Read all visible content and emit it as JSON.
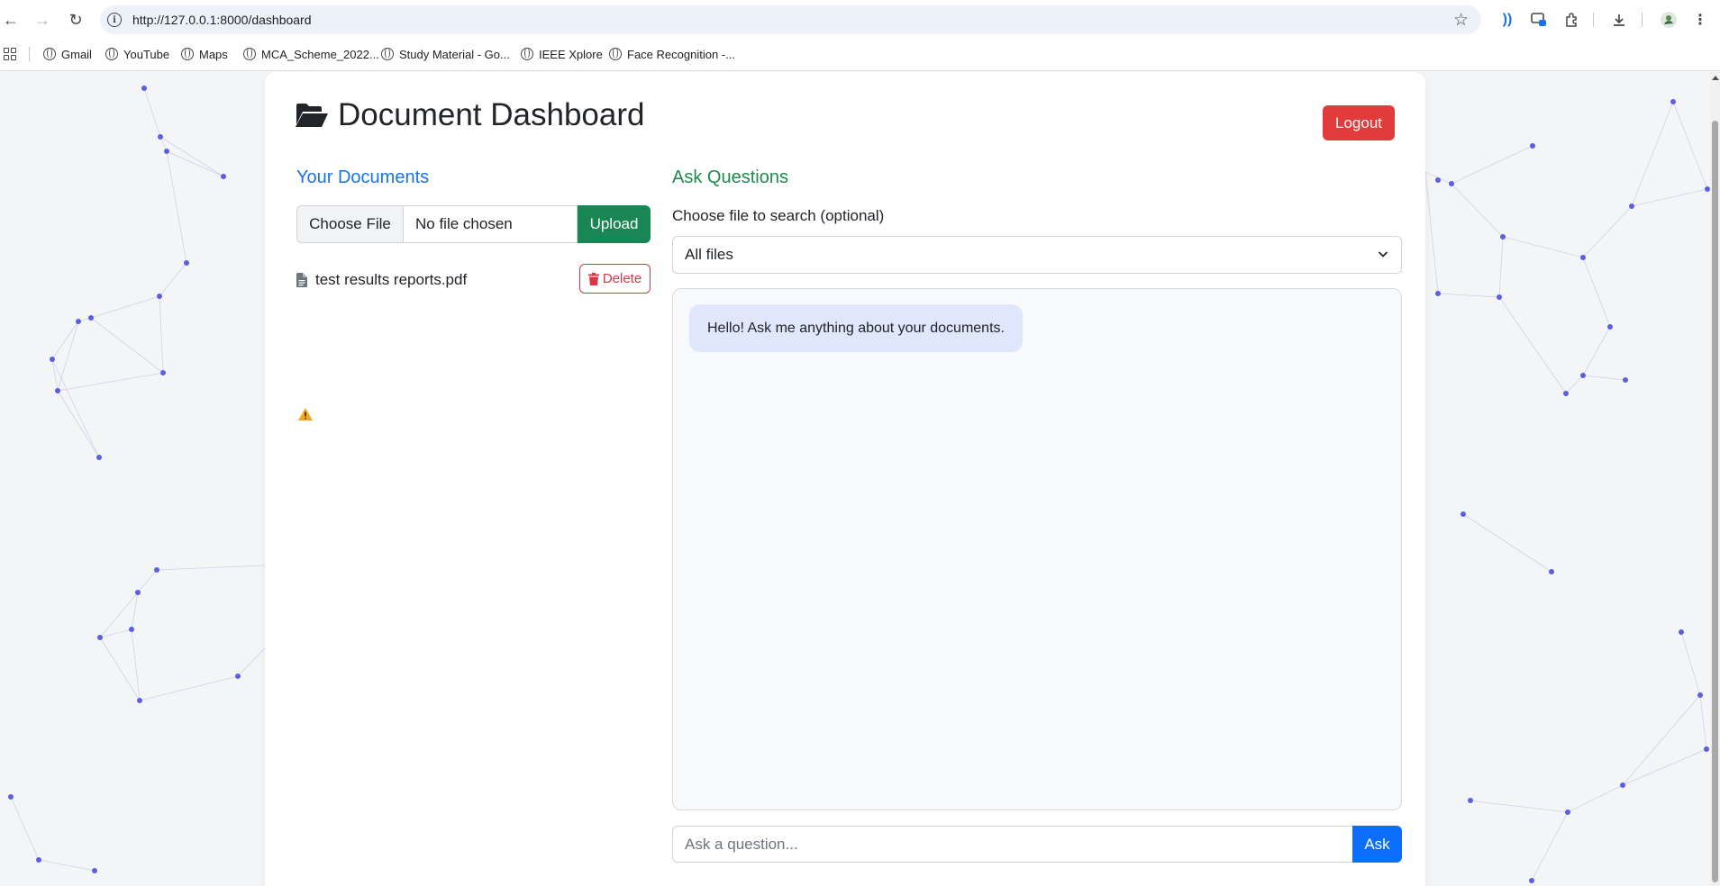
{
  "browser": {
    "url": "http://127.0.0.1:8000/dashboard",
    "bookmarks": [
      {
        "label": "Gmail"
      },
      {
        "label": "YouTube"
      },
      {
        "label": "Maps"
      },
      {
        "label": "MCA_Scheme_2022..."
      },
      {
        "label": "Study Material - Go..."
      },
      {
        "label": "IEEE Xplore"
      },
      {
        "label": "Face Recognition -..."
      }
    ]
  },
  "header": {
    "title": "Document Dashboard",
    "logout_label": "Logout"
  },
  "documents": {
    "section_title": "Your Documents",
    "choose_file_label": "Choose File",
    "no_file_label": "No file chosen",
    "upload_label": "Upload",
    "files": [
      {
        "name": "test results reports.pdf",
        "delete_label": "Delete"
      }
    ]
  },
  "ask": {
    "section_title": "Ask Questions",
    "select_label": "Choose file to search (optional)",
    "selected_option": "All files",
    "messages": [
      {
        "sender": "bot",
        "text": "Hello! Ask me anything about your documents."
      }
    ],
    "input_placeholder": "Ask a question...",
    "ask_label": "Ask"
  },
  "colors": {
    "primary": "#0d6efd",
    "success": "#198754",
    "danger": "#dc3545",
    "logout": "#e13b3b",
    "docs_title": "#1a73e8",
    "ask_title": "#1e8a4c",
    "node": "#5b5fe0"
  }
}
